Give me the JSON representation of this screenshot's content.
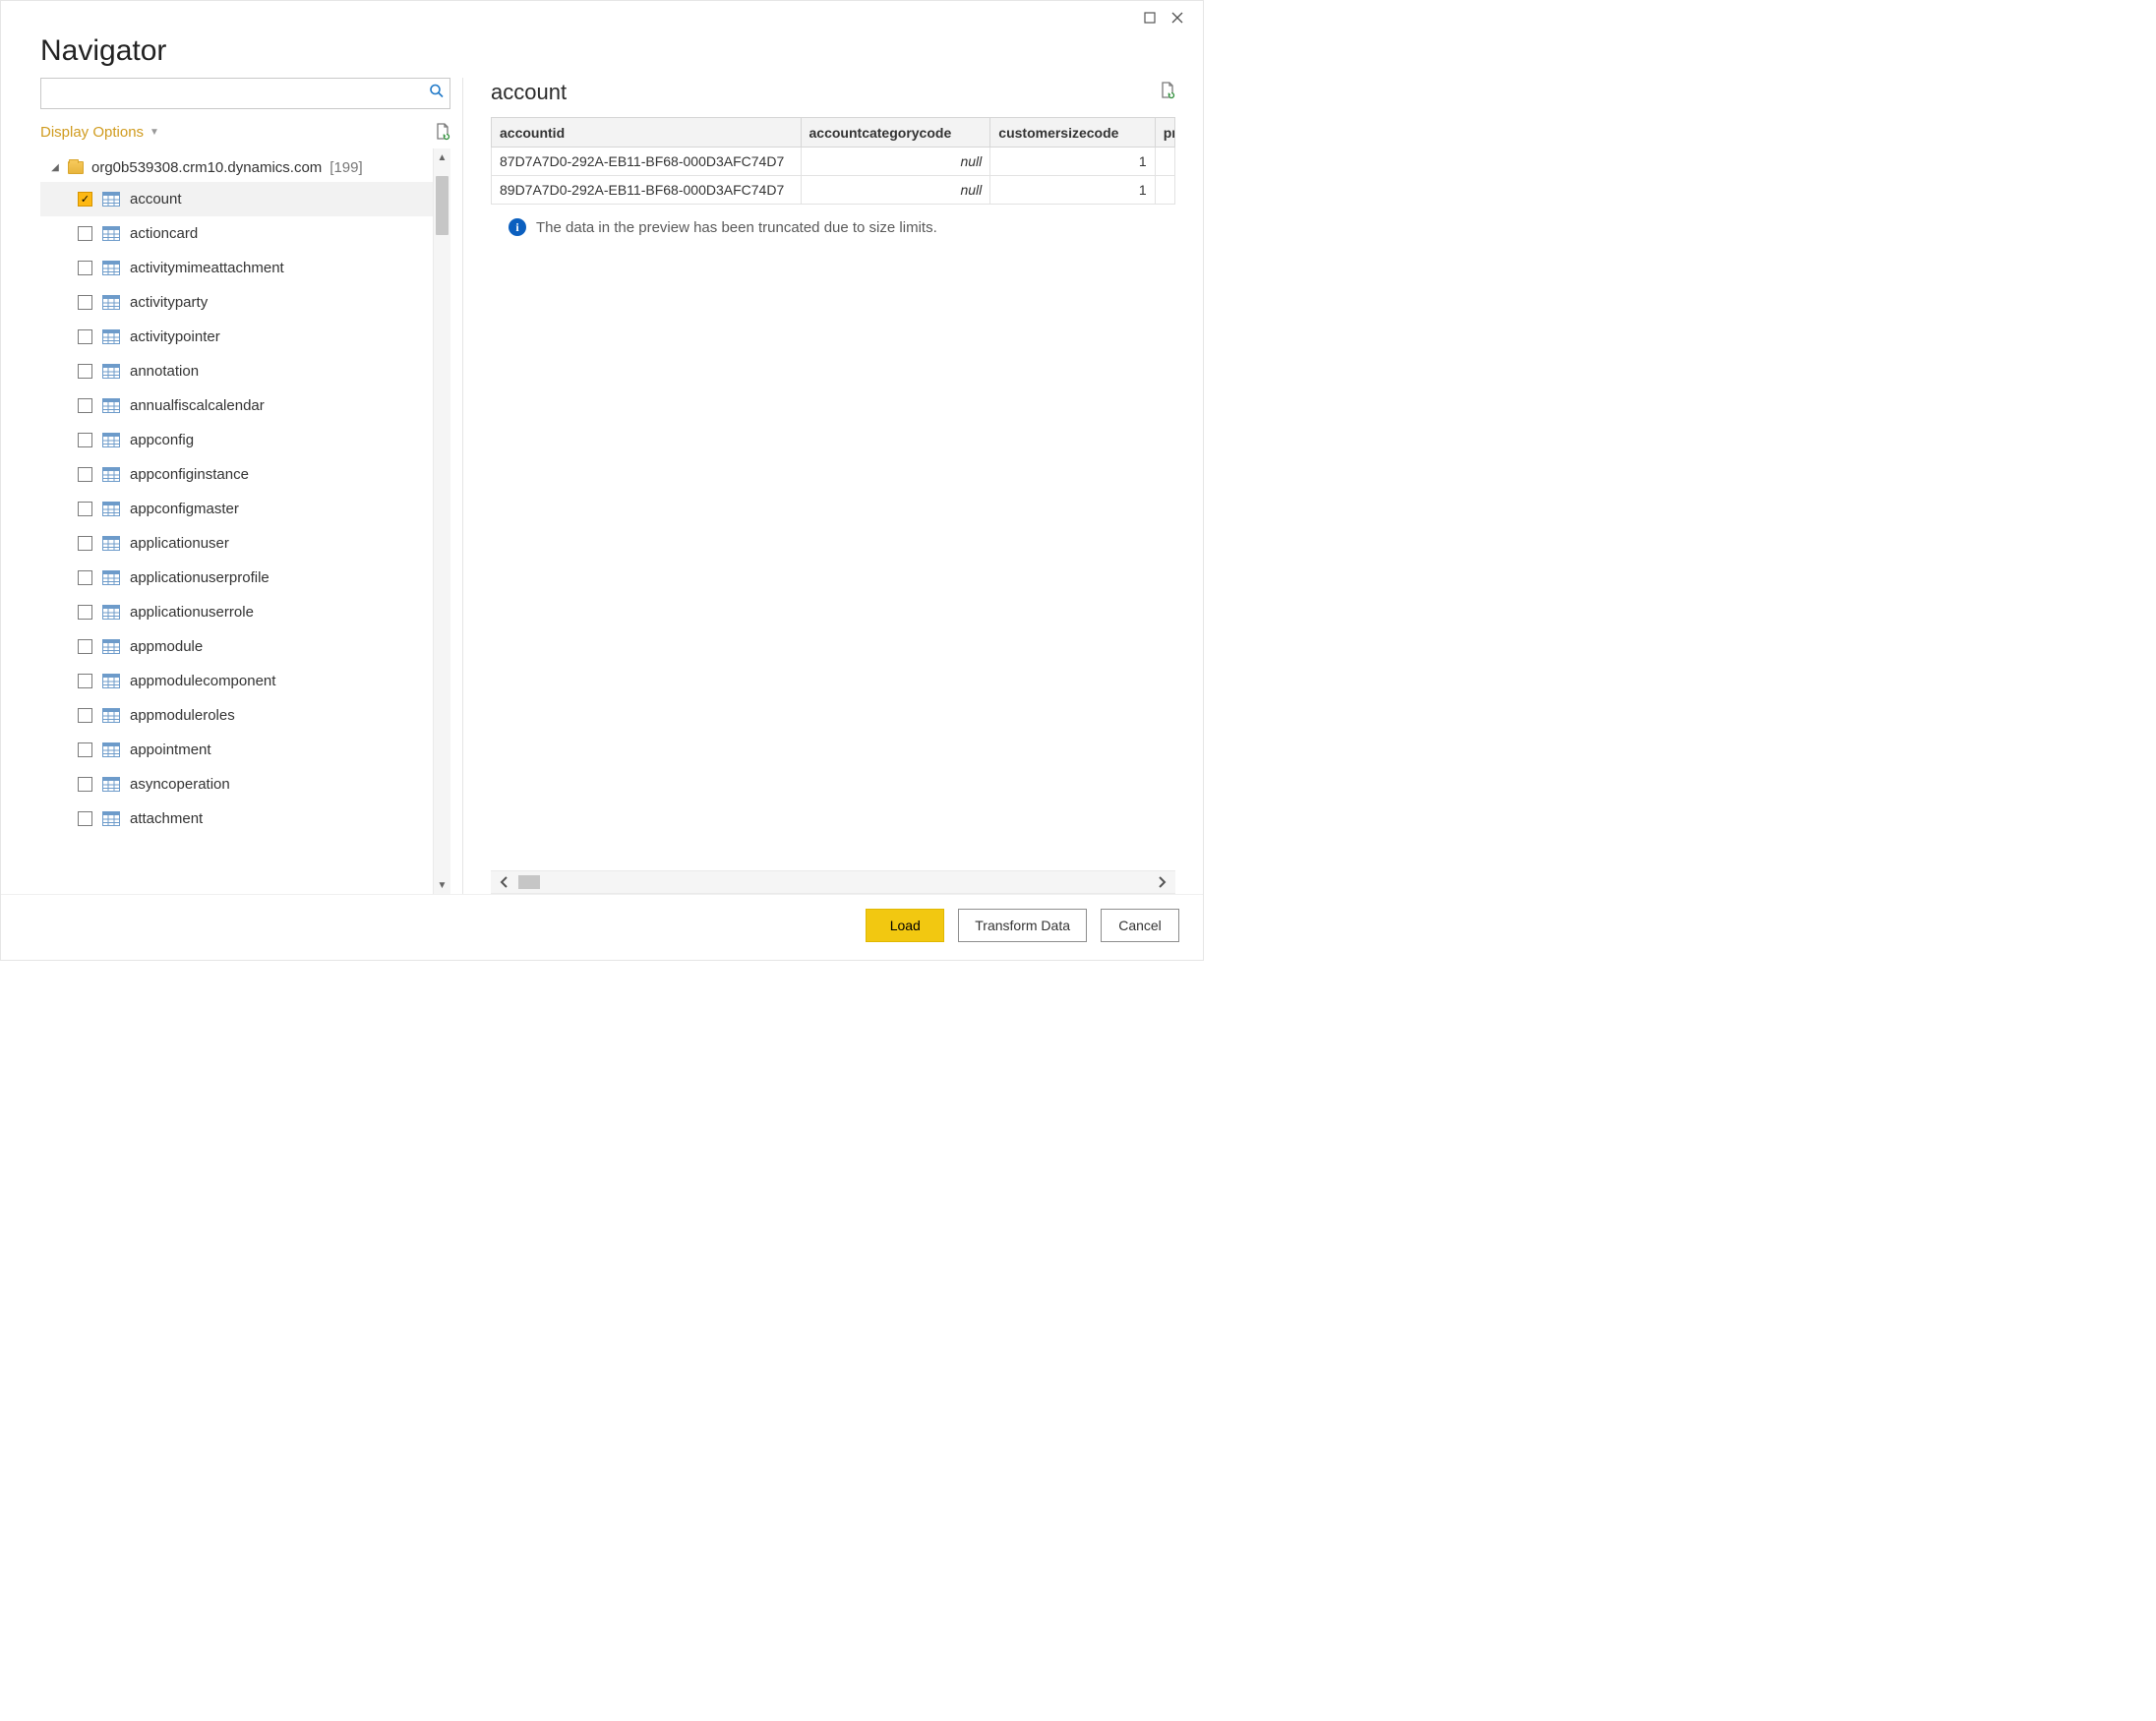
{
  "window": {
    "title": "Navigator"
  },
  "search": {
    "placeholder": ""
  },
  "display_options": {
    "label": "Display Options"
  },
  "tree": {
    "root_label": "org0b539308.crm10.dynamics.com",
    "root_count": "[199]",
    "items": [
      {
        "label": "account",
        "checked": true,
        "selected": true
      },
      {
        "label": "actioncard",
        "checked": false
      },
      {
        "label": "activitymimeattachment",
        "checked": false
      },
      {
        "label": "activityparty",
        "checked": false
      },
      {
        "label": "activitypointer",
        "checked": false
      },
      {
        "label": "annotation",
        "checked": false
      },
      {
        "label": "annualfiscalcalendar",
        "checked": false
      },
      {
        "label": "appconfig",
        "checked": false
      },
      {
        "label": "appconfiginstance",
        "checked": false
      },
      {
        "label": "appconfigmaster",
        "checked": false
      },
      {
        "label": "applicationuser",
        "checked": false
      },
      {
        "label": "applicationuserprofile",
        "checked": false
      },
      {
        "label": "applicationuserrole",
        "checked": false
      },
      {
        "label": "appmodule",
        "checked": false
      },
      {
        "label": "appmodulecomponent",
        "checked": false
      },
      {
        "label": "appmoduleroles",
        "checked": false
      },
      {
        "label": "appointment",
        "checked": false
      },
      {
        "label": "asyncoperation",
        "checked": false
      },
      {
        "label": "attachment",
        "checked": false
      }
    ]
  },
  "preview": {
    "title": "account",
    "columns": [
      "accountid",
      "accountcategorycode",
      "customersizecode",
      "pr"
    ],
    "rows": [
      {
        "accountid": "87D7A7D0-292A-EB11-BF68-000D3AFC74D7",
        "accountcategorycode": "null",
        "customersizecode": "1"
      },
      {
        "accountid": "89D7A7D0-292A-EB11-BF68-000D3AFC74D7",
        "accountcategorycode": "null",
        "customersizecode": "1"
      }
    ],
    "truncation_note": "The data in the preview has been truncated due to size limits."
  },
  "buttons": {
    "load": "Load",
    "transform": "Transform Data",
    "cancel": "Cancel"
  }
}
